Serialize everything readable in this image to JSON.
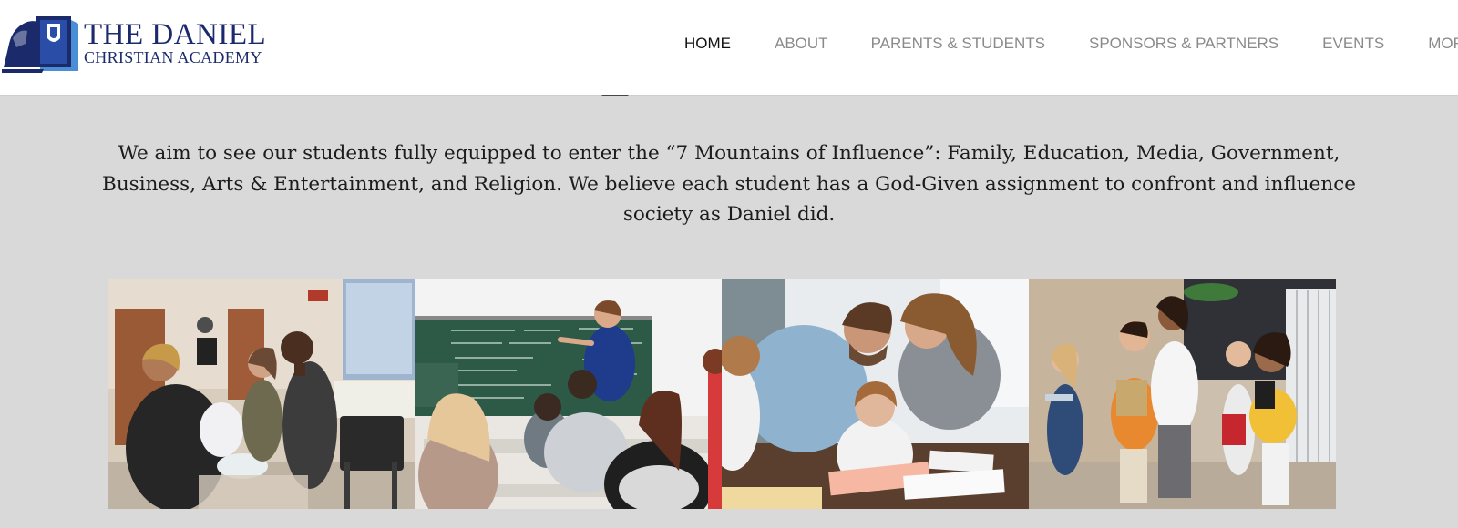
{
  "logo": {
    "line1": "THE DANIEL",
    "line2": "CHRISTIAN ACADEMY",
    "icon": "lion-shield-book-icon"
  },
  "nav": {
    "items": [
      {
        "label": "HOME",
        "active": true
      },
      {
        "label": "ABOUT",
        "active": false
      },
      {
        "label": "PARENTS & STUDENTS",
        "active": false
      },
      {
        "label": "SPONSORS & PARTNERS",
        "active": false
      },
      {
        "label": "EVENTS",
        "active": false
      },
      {
        "label": "MORE...",
        "active": false
      }
    ]
  },
  "mission": {
    "text": "We aim to see our students fully equipped to enter the “7 Mountains of Influence”: Family, Education, Media, Government, Business, Arts & Entertainment, and Religion. We believe each student has a God-Given assignment to confront and influence society as Daniel did."
  },
  "gallery": {
    "photos": [
      {
        "name": "students-science-project-photo"
      },
      {
        "name": "math-classroom-chalkboard-photo"
      },
      {
        "name": "teachers-helping-girl-write-photo"
      },
      {
        "name": "children-walking-school-hallway-photo"
      }
    ]
  },
  "colors": {
    "brand_navy": "#1b2a6b",
    "nav_active": "#111111",
    "nav_inactive": "#8a8a8a",
    "section_bg": "#d9d9d9",
    "header_bg": "#ffffff"
  }
}
